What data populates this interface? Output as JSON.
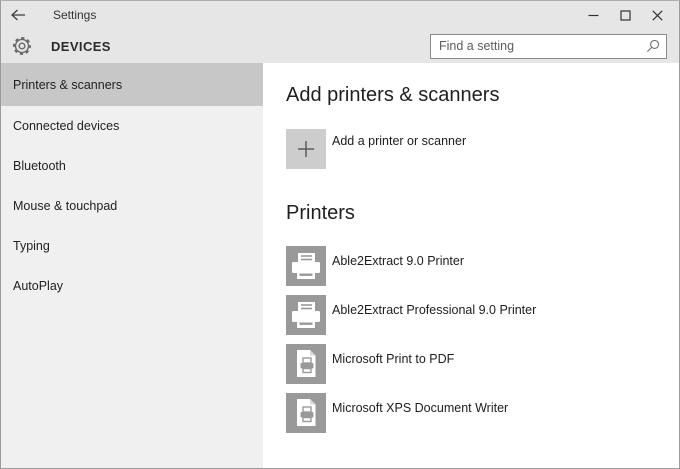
{
  "titlebar": {
    "title": "Settings",
    "back_icon": "back-arrow-icon",
    "controls": {
      "minimize_icon": "minimize-icon",
      "maximize_icon": "maximize-icon",
      "close_icon": "close-icon"
    }
  },
  "header": {
    "page_title": "DEVICES",
    "gear_icon": "settings-gear-icon",
    "search": {
      "placeholder": "Find a setting",
      "icon": "search-icon"
    }
  },
  "sidebar": {
    "items": [
      {
        "label": "Printers & scanners",
        "selected": true
      },
      {
        "label": "Connected devices",
        "selected": false
      },
      {
        "label": "Bluetooth",
        "selected": false
      },
      {
        "label": "Mouse & touchpad",
        "selected": false
      },
      {
        "label": "Typing",
        "selected": false
      },
      {
        "label": "AutoPlay",
        "selected": false
      }
    ]
  },
  "content": {
    "add_section": {
      "heading": "Add printers & scanners",
      "add_button_label": "Add a printer or scanner",
      "add_icon": "plus-icon"
    },
    "printers_section": {
      "heading": "Printers",
      "printers": [
        {
          "name": "Able2Extract 9.0 Printer",
          "icon": "printer-icon"
        },
        {
          "name": "Able2Extract Professional 9.0 Printer",
          "icon": "printer-icon"
        },
        {
          "name": "Microsoft Print to PDF",
          "icon": "document-printer-icon"
        },
        {
          "name": "Microsoft XPS Document Writer",
          "icon": "document-printer-icon"
        }
      ]
    }
  },
  "colors": {
    "chrome_bg": "#e6e6e6",
    "sidebar_bg": "#f0f0f0",
    "selected_item_bg": "#c7c7c7",
    "content_bg": "#ffffff",
    "printer_tile_gray": "#999999",
    "add_tile_gray": "#cdcdcd",
    "window_border": "#9b9b9b",
    "text_primary": "#1f1f1f"
  }
}
